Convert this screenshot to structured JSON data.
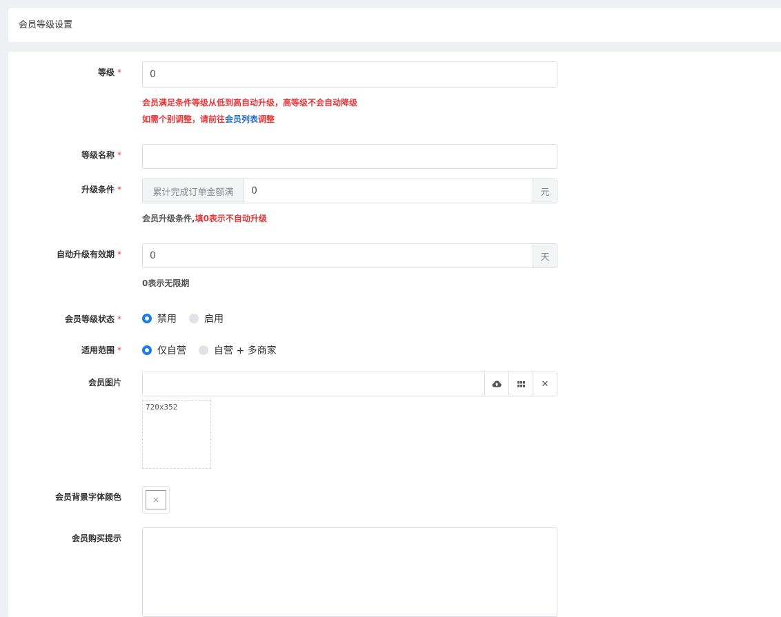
{
  "header": {
    "title": "会员等级设置"
  },
  "form": {
    "level": {
      "label": "等级",
      "required": "*",
      "value": "0",
      "hint_line1": "会员满足条件等级从低到高自动升级，高等级不会自动降级",
      "hint_line2_prefix": "如需个别调整，请前往",
      "hint_line2_link": "会员列表",
      "hint_line2_suffix": "调整"
    },
    "level_name": {
      "label": "等级名称",
      "required": "*",
      "value": ""
    },
    "upgrade_condition": {
      "label": "升级条件",
      "required": "*",
      "prefix": "累计完成订单金额满",
      "value": "0",
      "suffix": "元",
      "hint_gray": "会员升级条件,",
      "hint_red": "填0表示不自动升级"
    },
    "auto_upgrade_validity": {
      "label": "自动升级有效期",
      "required": "*",
      "value": "0",
      "suffix": "天",
      "hint": "0表示无限期"
    },
    "level_status": {
      "label": "会员等级状态",
      "required": "*",
      "options": [
        "禁用",
        "启用"
      ],
      "selected": "禁用"
    },
    "scope": {
      "label": "适用范围",
      "required": "*",
      "options": [
        "仅自营",
        "自营 + 多商家"
      ],
      "selected": "仅自营"
    },
    "member_image": {
      "label": "会员图片",
      "value": "",
      "upload_icon": "cloud-upload-icon",
      "gallery_icon": "grid-icon",
      "clear_icon": "close-icon",
      "clear_glyph": "✕",
      "placeholder_size": "720x352"
    },
    "bg_font_color": {
      "label": "会员背景字体颜色",
      "swatch_glyph": "×"
    },
    "purchase_tip": {
      "label": "会员购买提示",
      "value": ""
    }
  }
}
